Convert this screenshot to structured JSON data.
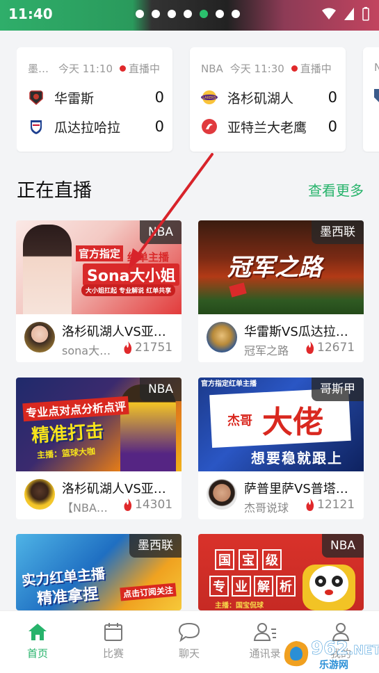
{
  "status": {
    "time": "11:40"
  },
  "banner": {
    "dots": 7,
    "active_dot": 4
  },
  "matches": [
    {
      "league": "墨西哥超",
      "time": "今天 11:10",
      "status": "直播中",
      "home": {
        "name": "华雷斯",
        "score": "0"
      },
      "away": {
        "name": "瓜达拉哈拉",
        "score": "0"
      }
    },
    {
      "league": "NBA",
      "time": "今天 11:30",
      "status": "直播中",
      "home": {
        "name": "洛杉矶湖人",
        "score": "0"
      },
      "away": {
        "name": "亚特兰大老鹰",
        "score": "0"
      }
    },
    {
      "league": "N"
    }
  ],
  "section": {
    "title": "正在直播",
    "more": "查看更多"
  },
  "streams": [
    {
      "tag": "NBA",
      "title": "洛杉矶湖人VS亚特兰大老鹰",
      "host": "sona大小姐",
      "hot": "21751",
      "thumb_lines": [
        "官方指定",
        "红单主播",
        "Sona大小姐",
        "大小姐扛起  专业解说  红单共享"
      ]
    },
    {
      "tag": "墨西联",
      "title": "华雷斯VS瓜达拉哈拉",
      "host": "冠军之路",
      "hot": "12671",
      "thumb_lines": [
        "冠军之路"
      ]
    },
    {
      "tag": "NBA",
      "title": "洛杉矶湖人VS亚特兰大老鹰",
      "host": "【NBA】专业分析",
      "hot": "14301",
      "thumb_lines": [
        "专业点对点分析点评",
        "精准打击",
        "主播：篮球大咖"
      ]
    },
    {
      "tag": "哥斯甲",
      "title": "萨普里萨VS普塔雷纳斯",
      "host": "杰哥说球",
      "hot": "12121",
      "thumb_lines": [
        "官方指定红单主播",
        "杰哥",
        "大佬",
        "想要稳就跟上"
      ]
    },
    {
      "tag": "墨西联",
      "thumb_lines": [
        "实力红单主播",
        "精准拿捏",
        "点击订阅关注"
      ]
    },
    {
      "tag": "NBA",
      "thumb_lines": [
        "国",
        "宝",
        "级",
        "专",
        "业",
        "解",
        "析",
        "主播：国宝侃球"
      ]
    }
  ],
  "tabs": [
    {
      "label": "首页",
      "icon": "home-icon",
      "active": true
    },
    {
      "label": "比赛",
      "icon": "calendar-icon"
    },
    {
      "label": "聊天",
      "icon": "chat-icon"
    },
    {
      "label": "通讯录",
      "icon": "contacts-icon"
    },
    {
      "label": "我的",
      "icon": "user-icon"
    }
  ],
  "watermark": {
    "brand": "962",
    "suffix": ".NET",
    "sub": "乐游网"
  },
  "colors": {
    "accent": "#27b36b",
    "live": "#e0292b",
    "arrow": "#d8232a"
  }
}
